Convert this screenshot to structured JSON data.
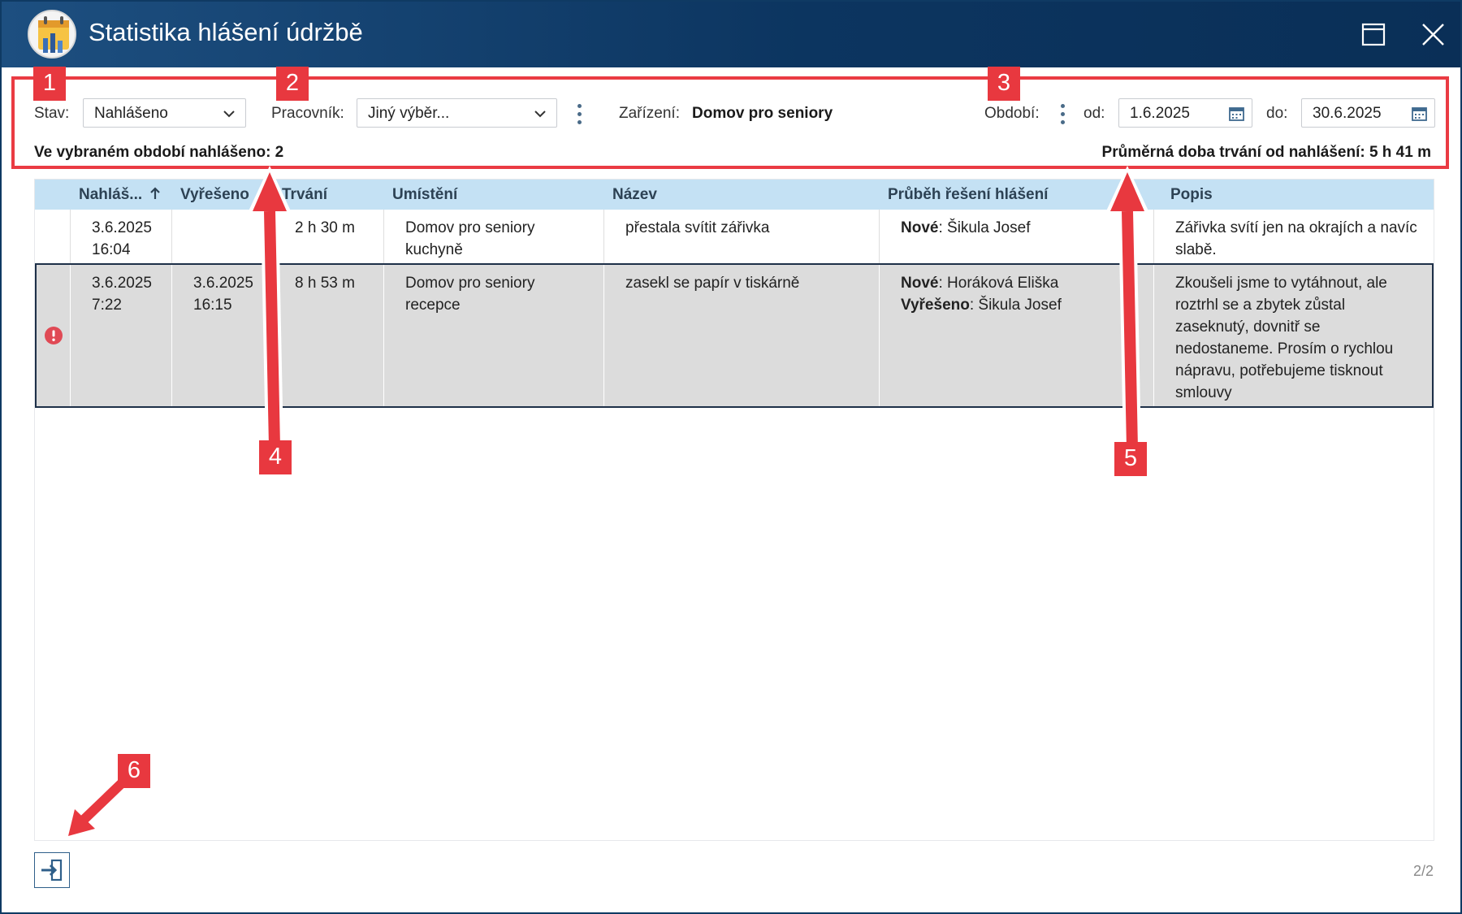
{
  "window": {
    "title": "Statistika hlášení údržbě"
  },
  "filters": {
    "stav_label": "Stav:",
    "stav_value": "Nahlášeno",
    "pracovnik_label": "Pracovník:",
    "pracovnik_value": "Jiný výběr...",
    "zarizeni_label": "Zařízení:",
    "zarizeni_value": "Domov pro seniory",
    "obdobi_label": "Období:",
    "od_label": "od:",
    "od_value": "1.6.2025",
    "do_label": "do:",
    "do_value": "30.6.2025"
  },
  "summary": {
    "count_text": "Ve vybraném období nahlášeno: 2",
    "average_text": "Průměrná doba trvání od nahlášení: 5 h 41 m"
  },
  "table": {
    "columns": [
      "Nahláš...",
      "Vyřešeno",
      "Trvání",
      "Umístění",
      "Název",
      "Průběh řešení hlášení",
      "Popis"
    ],
    "sort_icon": "arrow-up-icon",
    "rows": [
      {
        "reported_date": "3.6.2025",
        "reported_time": "16:04",
        "resolved_date": "",
        "resolved_time": "",
        "duration": "2 h 30 m",
        "location_1": "Domov pro seniory",
        "location_2": "kuchyně",
        "name": "přestala svítit zářivka",
        "progress": [
          {
            "status": "Nové",
            "sep": ":",
            "person": " Šikula Josef"
          }
        ],
        "description": "Zářivka svítí jen na okrajích a navíc slabě.",
        "error": false
      },
      {
        "reported_date": "3.6.2025",
        "reported_time": "7:22",
        "resolved_date": "3.6.2025",
        "resolved_time": "16:15",
        "duration": "8 h 53 m",
        "location_1": "Domov pro seniory",
        "location_2": "recepce",
        "name": "zasekl se papír v tiskárně",
        "progress": [
          {
            "status": "Nové",
            "sep": ":",
            "person": " Horáková Eliška"
          },
          {
            "status": "Vyřešeno",
            "sep": ":",
            "person": " Šikula Josef"
          }
        ],
        "description": "Zkoušeli jsme to vytáhnout, ale roztrhl se a zbytek zůstal zaseknutý, dovnitř se nedostaneme. Prosím o rychlou nápravu, potřebujeme tisknout smlouvy",
        "error": true
      }
    ]
  },
  "footer": {
    "pager": "2/2",
    "export_icon": "export-icon"
  },
  "annotations": [
    "1",
    "2",
    "3",
    "4",
    "5",
    "6"
  ],
  "colors": {
    "titlebar": "#0c3560",
    "header": "#c4e1f4",
    "annotation": "#e8383f",
    "selected_row": "#dcdcdc",
    "error": "#e04a55"
  }
}
